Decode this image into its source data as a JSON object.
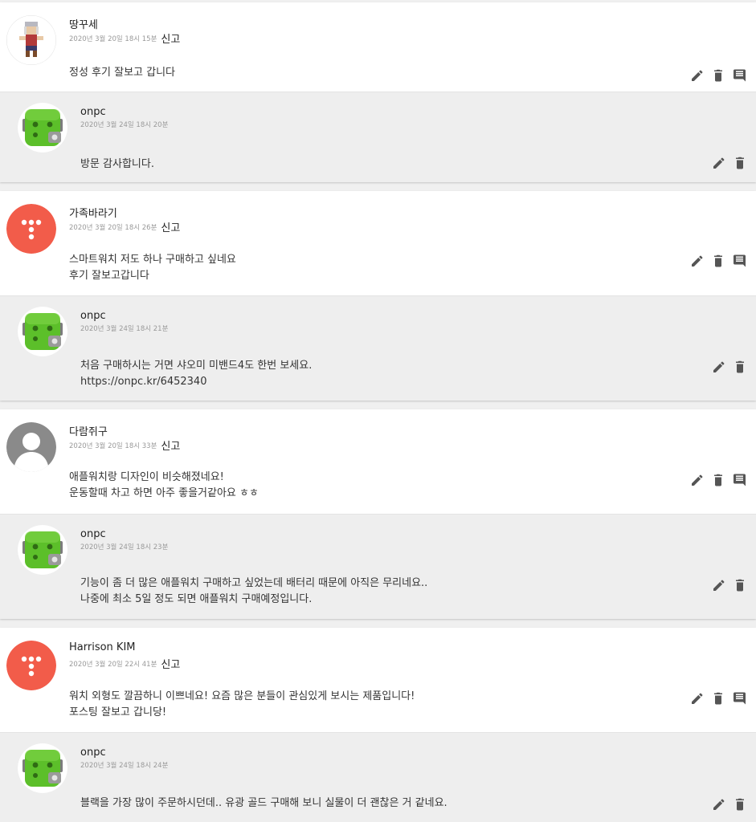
{
  "report_label": "신고",
  "threads": [
    {
      "comment": {
        "author": "땅꾸세",
        "date": "2020년 3월 20일 18시 15분",
        "avatar": "pixel-character-avatar",
        "lines": [
          "정성 후기 잘보고 갑니다"
        ]
      },
      "reply": {
        "author": "onpc",
        "date": "2020년 3월 24일 18시 20분",
        "avatar": "green-robot-avatar",
        "lines": [
          "방문 감사합니다."
        ]
      }
    },
    {
      "comment": {
        "author": "가족바라기",
        "date": "2020년 3월 20일 18시 26분",
        "avatar": "red-dots-avatar",
        "lines": [
          "스마트워치 저도 하나 구매하고 싶네요",
          "후기 잘보고갑니다"
        ]
      },
      "reply": {
        "author": "onpc",
        "date": "2020년 3월 24일 18시 21분",
        "avatar": "green-robot-avatar",
        "lines": [
          "처음 구매하시는 거면 샤오미 미밴드4도 한번 보세요.",
          "https://onpc.kr/6452340"
        ]
      }
    },
    {
      "comment": {
        "author": "다람쥐구",
        "date": "2020년 3월 20일 18시 33분",
        "avatar": "default-person-avatar",
        "lines": [
          "애플워치랑 디자인이 비슷해졌네요!",
          "운동할때 차고 하면 아주 좋을거같아요 ㅎㅎ"
        ]
      },
      "reply": {
        "author": "onpc",
        "date": "2020년 3월 24일 18시 23분",
        "avatar": "green-robot-avatar",
        "lines": [
          "기능이 좀 더 많은 애플워치 구매하고 싶었는데 배터리 때문에 아직은 무리네요..",
          "나중에 최소 5일 정도 되면 애플워치 구매예정입니다."
        ]
      }
    },
    {
      "comment": {
        "author": "Harrison KIM",
        "date": "2020년 3월 20일 22시 41분",
        "avatar": "red-dots-avatar",
        "lines": [
          "워치 외형도 깔끔하니 이쁘네요! 요즘 많은 분들이 관심있게 보시는 제품입니다!",
          "포스팅 잘보고 갑니당!"
        ]
      },
      "reply": {
        "author": "onpc",
        "date": "2020년 3월 24일 18시 24분",
        "avatar": "green-robot-avatar",
        "lines": [
          "블랙을 가장 많이 주문하시던데.. 유광 골드 구매해 보니 실물이 더 괜찮은 거 같네요."
        ]
      }
    }
  ],
  "colors": {
    "icon": "#555555",
    "reply_bg": "#eeeeee",
    "meta_text": "#999999",
    "red_avatar": "#f25c4a",
    "green_avatar": "#5cbf2a"
  }
}
